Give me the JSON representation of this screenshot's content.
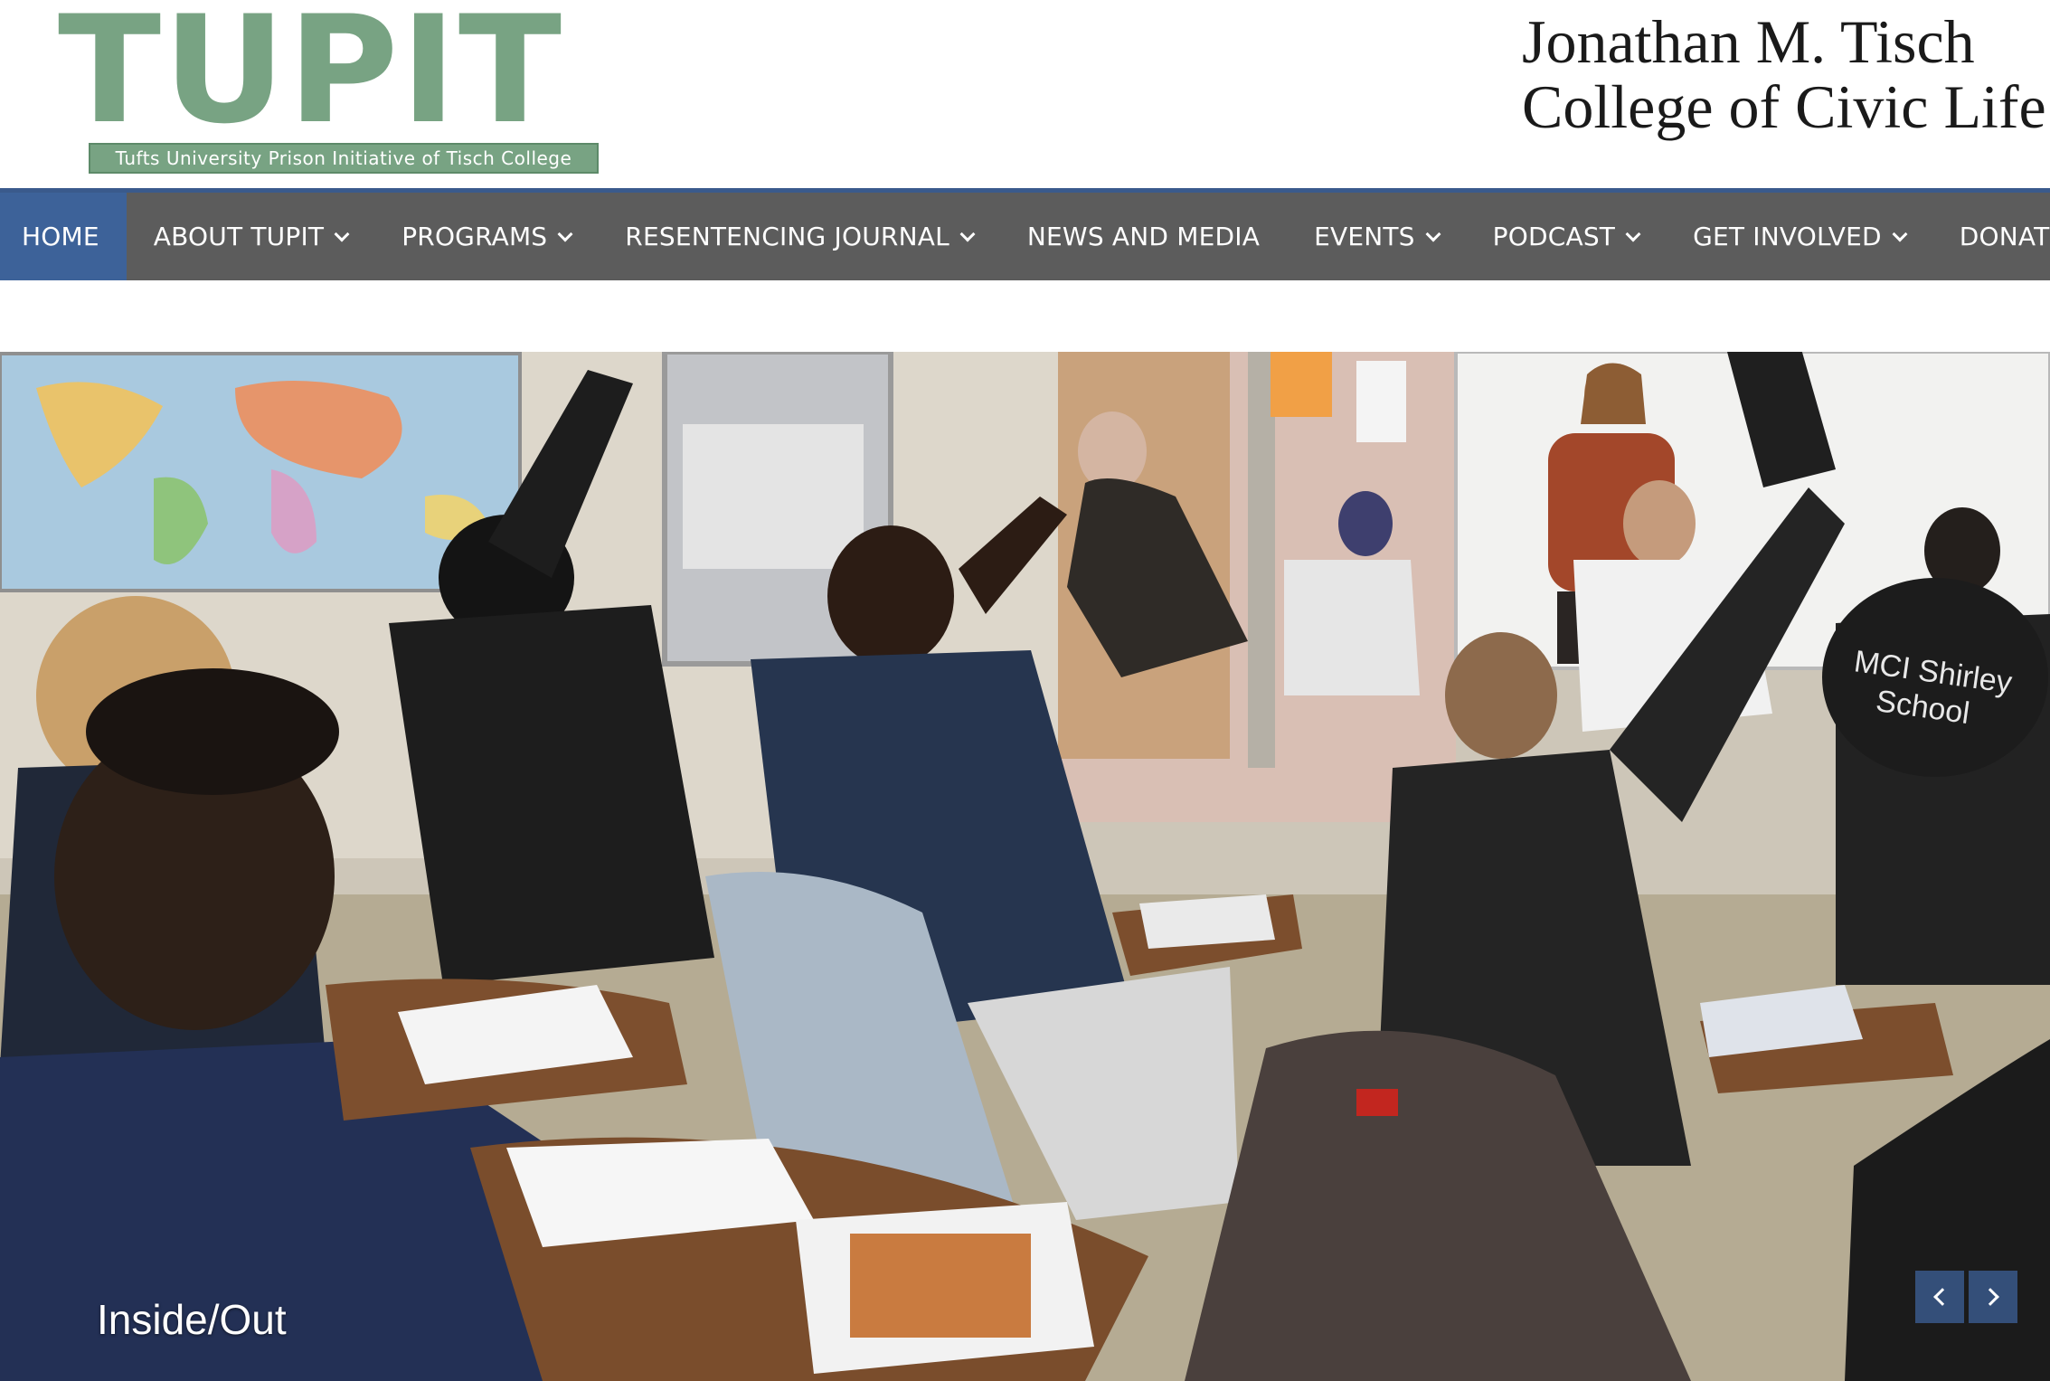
{
  "header": {
    "logo_text": "TUPIT",
    "logo_tagline": "Tufts University Prison Initiative of Tisch College",
    "college_line1": "Jonathan M. Tisch",
    "college_line2": "College of Civic Life"
  },
  "nav": {
    "items": [
      {
        "label": "HOME",
        "active": true,
        "dropdown": false
      },
      {
        "label": "ABOUT TUPIT",
        "active": false,
        "dropdown": true
      },
      {
        "label": "PROGRAMS",
        "active": false,
        "dropdown": true
      },
      {
        "label": "RESENTENCING JOURNAL",
        "active": false,
        "dropdown": true
      },
      {
        "label": "NEWS AND MEDIA",
        "active": false,
        "dropdown": false
      },
      {
        "label": "EVENTS",
        "active": false,
        "dropdown": true
      },
      {
        "label": "PODCAST",
        "active": false,
        "dropdown": true
      },
      {
        "label": "GET INVOLVED",
        "active": false,
        "dropdown": true
      },
      {
        "label": "DONATE",
        "active": false,
        "dropdown": false
      }
    ]
  },
  "hero": {
    "caption": "Inside/Out",
    "photo_chair_text_1": "MCI Shirley",
    "photo_chair_text_2": "School",
    "prev_icon": "chevron-left-icon",
    "next_icon": "chevron-right-icon"
  },
  "colors": {
    "logo_green": "#78a383",
    "nav_bg": "#5c5c5c",
    "nav_active": "#3d6299",
    "nav_border": "#3a5a8c"
  }
}
